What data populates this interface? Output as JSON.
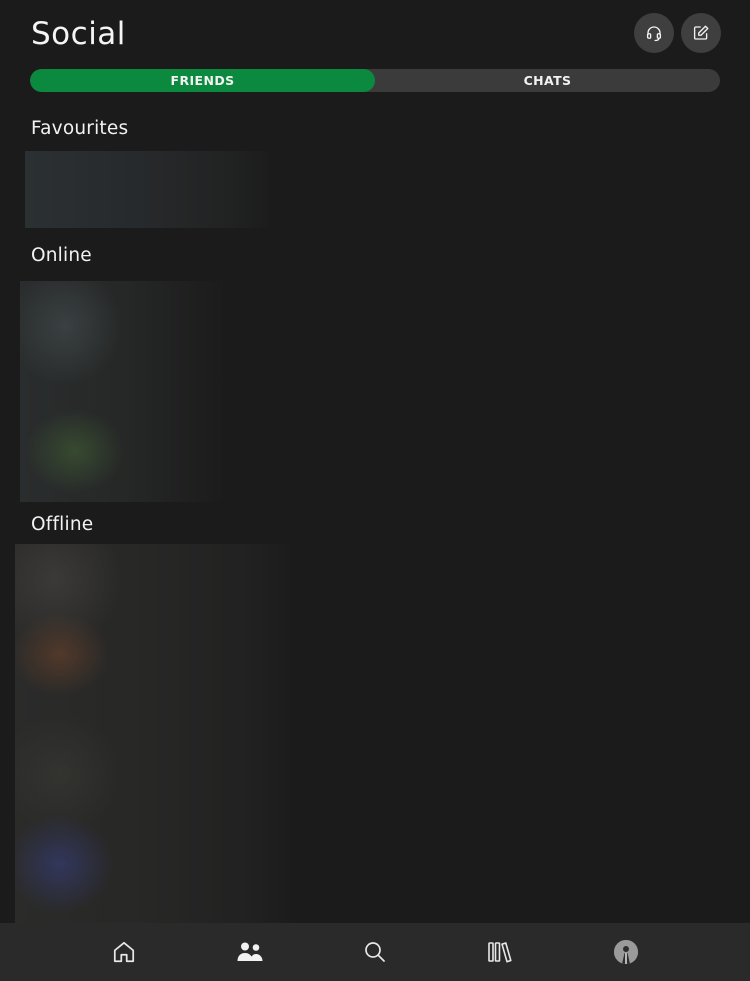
{
  "header": {
    "title": "Social",
    "party_icon": "headset-icon",
    "compose_icon": "compose-icon"
  },
  "tabs": [
    {
      "label": "FRIENDS",
      "active": true
    },
    {
      "label": "CHATS",
      "active": false
    }
  ],
  "sections": {
    "favourites": "Favourites",
    "online": "Online",
    "offline": "Offline"
  },
  "bottom_nav": [
    {
      "icon": "home-icon",
      "active": false
    },
    {
      "icon": "people-icon",
      "active": true
    },
    {
      "icon": "search-icon",
      "active": false
    },
    {
      "icon": "library-icon",
      "active": false
    },
    {
      "icon": "profile-avatar",
      "active": false
    }
  ],
  "colors": {
    "accent": "#0b8a3f",
    "background": "#1b1b1b",
    "nav_background": "#2a2a2a"
  }
}
